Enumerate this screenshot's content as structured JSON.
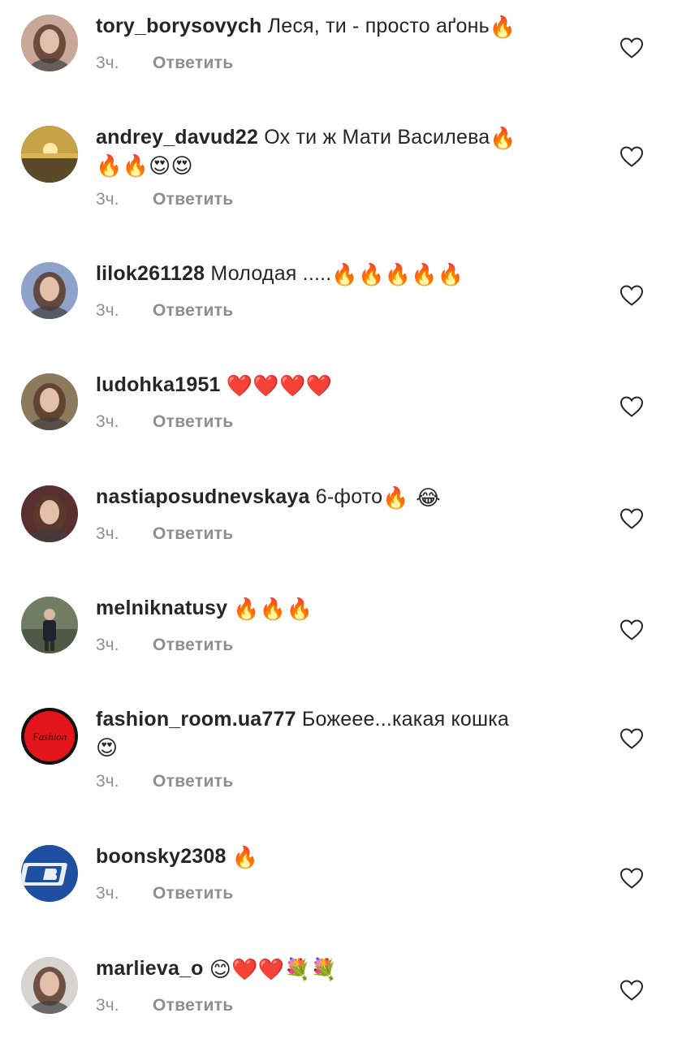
{
  "reply_label": "Ответить",
  "comments": [
    {
      "username": "tory_borysovych",
      "line1": "Леся, ти - просто аґонь",
      "line1_emoji": "🔥",
      "line2_emoji": "",
      "time": "3ч.",
      "avatar_icon": "woman-portrait",
      "avatar_color": "#c9a89a"
    },
    {
      "username": "andrey_davud22",
      "line1": "Ох ти ж Мати Василева",
      "line1_emoji": "🔥",
      "line2_emoji": "🔥🔥😍😍",
      "time": "3ч.",
      "avatar_icon": "sunset-landscape",
      "avatar_color": "#c8a247"
    },
    {
      "username": "lilok261128",
      "line1": "Молодая .....",
      "line1_emoji": "🔥🔥🔥🔥🔥",
      "line2_emoji": "",
      "time": "3ч.",
      "avatar_icon": "woman-portrait",
      "avatar_color": "#8fa2c9"
    },
    {
      "username": "ludohka1951",
      "line1": "",
      "line1_emoji": "❤️❤️❤️❤️",
      "line2_emoji": "",
      "time": "3ч.",
      "avatar_icon": "woman-portrait",
      "avatar_color": "#8c7a5c"
    },
    {
      "username": "nastiaposudnevskaya",
      "line1": "6-фото",
      "line1_emoji": "🔥 😂",
      "line2_emoji": "",
      "time": "3ч.",
      "avatar_icon": "woman-portrait",
      "avatar_color": "#5a2f2f"
    },
    {
      "username": "melniknatusy",
      "line1": "",
      "line1_emoji": "🔥🔥🔥",
      "line2_emoji": "",
      "time": "3ч.",
      "avatar_icon": "person-outdoors",
      "avatar_color": "#6f7d62"
    },
    {
      "username": "fashion_room.ua777",
      "line1": "Божеее...какая кошка",
      "line1_emoji": "",
      "line2_emoji": "😍",
      "time": "3ч.",
      "avatar_icon": "fashion-logo",
      "avatar_color": "#e3151a",
      "avatar_text": "Fashion"
    },
    {
      "username": "boonsky2308",
      "line1": "",
      "line1_emoji": "🔥",
      "line2_emoji": "",
      "time": "3ч.",
      "avatar_icon": "b-logo",
      "avatar_color": "#1f4fa3"
    },
    {
      "username": "marlieva_o",
      "line1": "",
      "line1_emoji": "😊❤️❤️💐💐",
      "line2_emoji": "",
      "time": "3ч.",
      "avatar_icon": "woman-portrait",
      "avatar_color": "#d7d3cf"
    }
  ],
  "like_icon": "heart-outline-icon"
}
